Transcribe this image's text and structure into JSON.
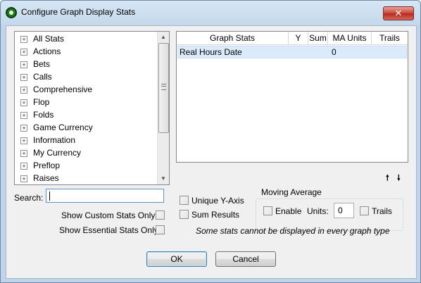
{
  "window": {
    "title": "Configure Graph Display Stats",
    "close_label": "✕"
  },
  "tree": {
    "items": [
      {
        "label": "All Stats",
        "expander": "+"
      },
      {
        "label": "Actions",
        "expander": "+"
      },
      {
        "label": "Bets",
        "expander": "+"
      },
      {
        "label": "Calls",
        "expander": "+"
      },
      {
        "label": "Comprehensive",
        "expander": "+"
      },
      {
        "label": "Flop",
        "expander": "+"
      },
      {
        "label": "Folds",
        "expander": "+"
      },
      {
        "label": "Game Currency",
        "expander": "+"
      },
      {
        "label": "Information",
        "expander": "+"
      },
      {
        "label": "My Currency",
        "expander": "+"
      },
      {
        "label": "Preflop",
        "expander": "+"
      },
      {
        "label": "Raises",
        "expander": "+"
      }
    ],
    "scroll_up": "▲",
    "scroll_down": "▼"
  },
  "table": {
    "columns": [
      "Graph Stats",
      "Y",
      "Sum",
      "MA Units",
      "Trails"
    ],
    "rows": [
      {
        "graph_stats": "Real Hours Date",
        "y": "",
        "sum": "",
        "ma_units": "0",
        "trails": ""
      }
    ]
  },
  "arrows": {
    "up": "🠕",
    "down": "🠗"
  },
  "search": {
    "label": "Search:",
    "value": ""
  },
  "options": {
    "show_custom": "Show Custom Stats Only",
    "show_essential": "Show Essential Stats Only",
    "unique_y": "Unique Y-Axis",
    "sum_results": "Sum Results"
  },
  "moving_average": {
    "title": "Moving Average",
    "enable": "Enable",
    "units_label": "Units:",
    "units_value": "0",
    "trails": "Trails"
  },
  "note": "Some stats cannot be displayed in every graph type",
  "buttons": {
    "ok": "OK",
    "cancel": "Cancel"
  },
  "colors": {
    "title_bar": "#c4d8ec",
    "selected_row": "#dcebfc",
    "close_button": "#c8453a"
  }
}
